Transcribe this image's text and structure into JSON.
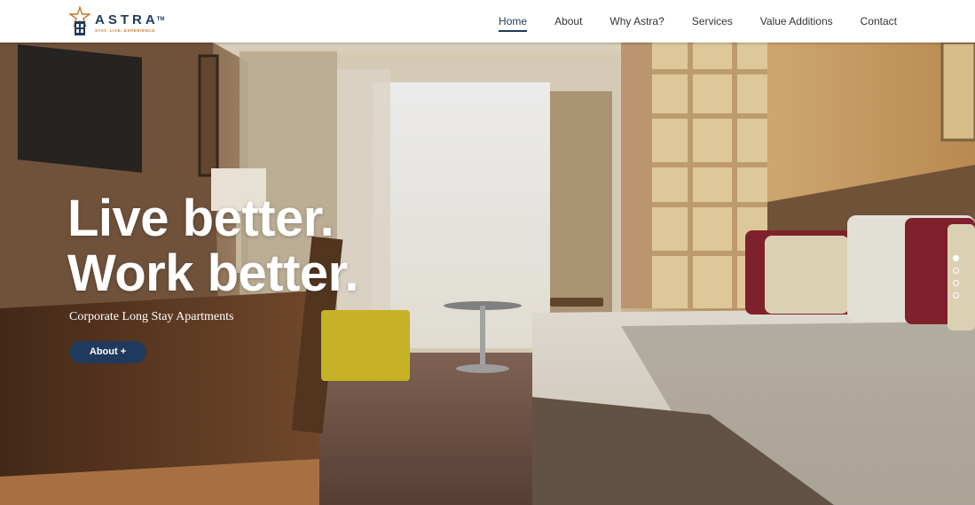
{
  "brand": {
    "name": "ASTRA",
    "tm": "TM",
    "tagline": "STAY. LIVE. EXPERIENCE",
    "colors": {
      "primary": "#1f3a5c",
      "accent": "#c8742a"
    }
  },
  "nav": {
    "items": [
      {
        "label": "Home",
        "active": true
      },
      {
        "label": "About",
        "active": false
      },
      {
        "label": "Why Astra?",
        "active": false
      },
      {
        "label": "Services",
        "active": false
      },
      {
        "label": "Value Additions",
        "active": false
      },
      {
        "label": "Contact",
        "active": false
      }
    ]
  },
  "hero": {
    "headline_line1": "Live better.",
    "headline_line2": "Work better.",
    "subheading": "Corporate Long Stay Apartments",
    "button_label": "About +",
    "slides": {
      "count": 4,
      "active_index": 0
    },
    "image": "hotel-room-photo"
  }
}
